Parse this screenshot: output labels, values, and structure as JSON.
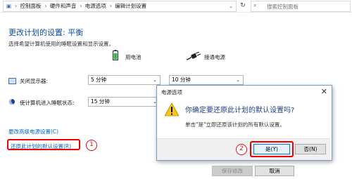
{
  "address_bar": {
    "crumbs": [
      "控制面板",
      "硬件和声音",
      "电源选项",
      "编辑计划设置"
    ],
    "search_placeholder": "搜索控制面板"
  },
  "page": {
    "title": "更改计划的设置: 平衡",
    "subtitle": "选择希望计算机使用的睡眠设置和显示设置。",
    "col_battery": "用电池",
    "col_plugged": "接通电源",
    "rows": [
      {
        "label": "关闭显示器:",
        "battery": "5 分钟",
        "plugged": "10 分钟"
      },
      {
        "label": "使计算机进入睡眠状态:",
        "battery": "15 分钟",
        "plugged": ""
      }
    ],
    "advanced_link": "更改高级电源设置(C)",
    "restore_link": "还原此计划的默认设置(R)",
    "save_button": "保存修改",
    "cancel_button": "取消"
  },
  "annotations": {
    "step1": "1",
    "step2": "2",
    "accent": "#dd1111"
  },
  "dialog": {
    "title": "电源选项",
    "message": "你确定要还原此计划的默认设置吗?",
    "detail": "单击\"是\"立即还原该计划的所有默认设置。",
    "yes_button": "是(Y)",
    "no_button": "否(N)"
  }
}
